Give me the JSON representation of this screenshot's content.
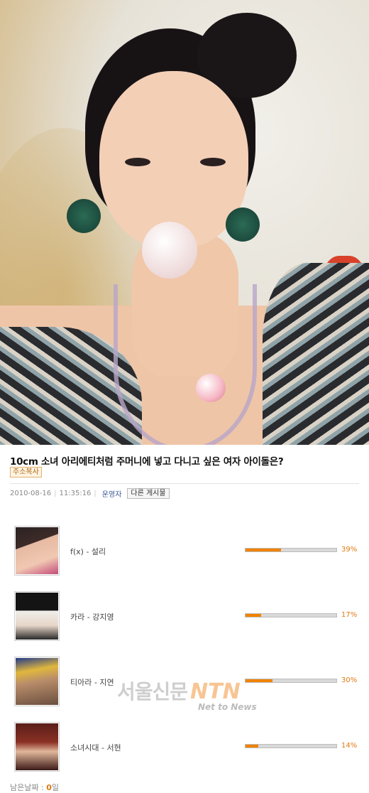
{
  "article": {
    "title": "10cm 소녀 아리에티처럼 주머니에 넣고 다니고 싶은 여자 아이돌은?",
    "copy_link_label": "주소복사",
    "date": "2010-08-16",
    "time": "11:35:16",
    "author": "운영자",
    "other_posts_label": "다른 게시물"
  },
  "poll": {
    "options": [
      {
        "label": "f(x) - 설리",
        "percent_text": "39%",
        "percent": 39
      },
      {
        "label": "카라 - 강지영",
        "percent_text": "17%",
        "percent": 17
      },
      {
        "label": "티아라 - 지연",
        "percent_text": "30%",
        "percent": 30
      },
      {
        "label": "소녀시대 - 서현",
        "percent_text": "14%",
        "percent": 14
      }
    ],
    "remaining_label": "남은날짜 :",
    "remaining_value": "0",
    "remaining_unit": "일",
    "bar_color": "#f08300"
  },
  "watermark": {
    "korean": "서울신문",
    "brand": "NTN",
    "tagline": "Net to News"
  }
}
